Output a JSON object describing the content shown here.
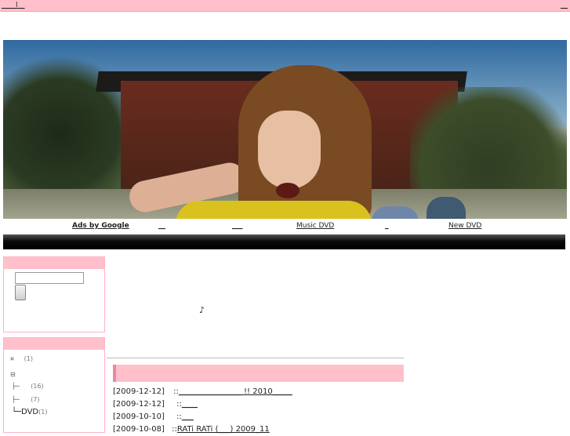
{
  "topbar": {
    "site_name": "____l__",
    "corner_link": "__"
  },
  "nav": {
    "ads": "Ads by Google",
    "link1": "__",
    "link2": "___",
    "link3": "Music DVD",
    "link4": "_",
    "link5": "New DVD"
  },
  "sidebar": {
    "search": {
      "input_value": ""
    },
    "categories": [
      {
        "icon": "¤",
        "label": "",
        "count": "(1)"
      },
      {
        "icon": "⊟",
        "label": "",
        "count": ""
      },
      {
        "icon": "├─",
        "label": "",
        "count": "(16)"
      },
      {
        "icon": "├─",
        "label": "",
        "count": "(7)"
      },
      {
        "icon": "└─",
        "label": "DVD",
        "count": "(1)"
      }
    ]
  },
  "main": {
    "note_icon": "♪",
    "entries": [
      {
        "date": "[2009-12-12]",
        "sep": "::",
        "title": "________________ !! 2010_____"
      },
      {
        "date": "[2009-12-12]",
        "sep": "::",
        "title": "____"
      },
      {
        "date": "[2009-10-10]",
        "sep": "::",
        "title": "___"
      },
      {
        "date": "[2009-10-08]",
        "sep": "::",
        "title": "RATi RATi (___) 2009_11"
      }
    ]
  },
  "colors": {
    "accent_pink": "#ffc0cb",
    "border_pink": "#ffb3c1",
    "bar_black": "#000000"
  }
}
